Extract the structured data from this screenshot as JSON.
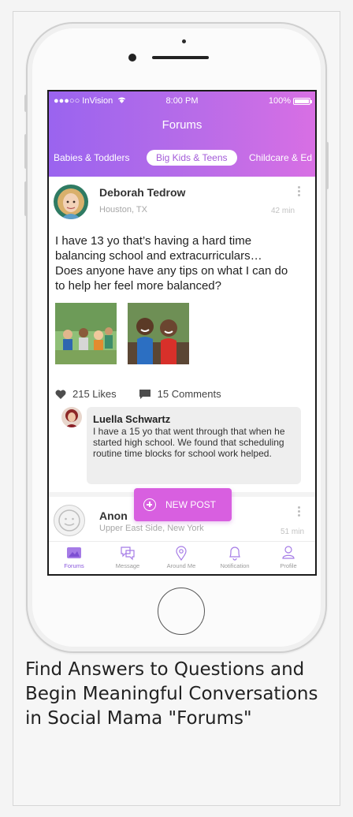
{
  "status_bar": {
    "carrier": "●●●○○ InVision",
    "time": "8:00 PM",
    "battery": "100%"
  },
  "header": {
    "title": "Forums"
  },
  "tabs": [
    {
      "label": "Babies & Toddlers",
      "active": false
    },
    {
      "label": "Big Kids & Teens",
      "active": true
    },
    {
      "label": "Childcare & Ed",
      "active": false
    }
  ],
  "post": {
    "author": "Deborah Tedrow",
    "location": "Houston, TX",
    "time": "42 min",
    "body": "I have 13 yo that’s having a hard time balancing school and extracurriculars… Does anyone have any tips on what I can do to help her feel more balanced?",
    "likes": "215 Likes",
    "comments": "15 Comments"
  },
  "comment": {
    "author": "Luella Schwartz",
    "text": "I have a 15 yo that went through that when he started high school. We found that scheduling routine time blocks for school work helped."
  },
  "post2": {
    "author": "Anon",
    "location": "Upper East Side, New York",
    "time": "51 min"
  },
  "new_post_label": "NEW POST",
  "nav": [
    {
      "label": "Forums",
      "icon": "forums-icon",
      "active": true
    },
    {
      "label": "Message",
      "icon": "message-icon",
      "active": false
    },
    {
      "label": "Around Me",
      "icon": "location-pin-icon",
      "active": false
    },
    {
      "label": "Notification",
      "icon": "bell-icon",
      "active": false
    },
    {
      "label": "Profile",
      "icon": "profile-icon",
      "active": false
    }
  ],
  "caption": "Find Answers to Questions and Begin Meaningful Conversations in Social Mama \"Forums\"",
  "colors": {
    "accent": "#9a64ef",
    "accent2": "#d86fe4",
    "fab": "#d85fe0"
  }
}
